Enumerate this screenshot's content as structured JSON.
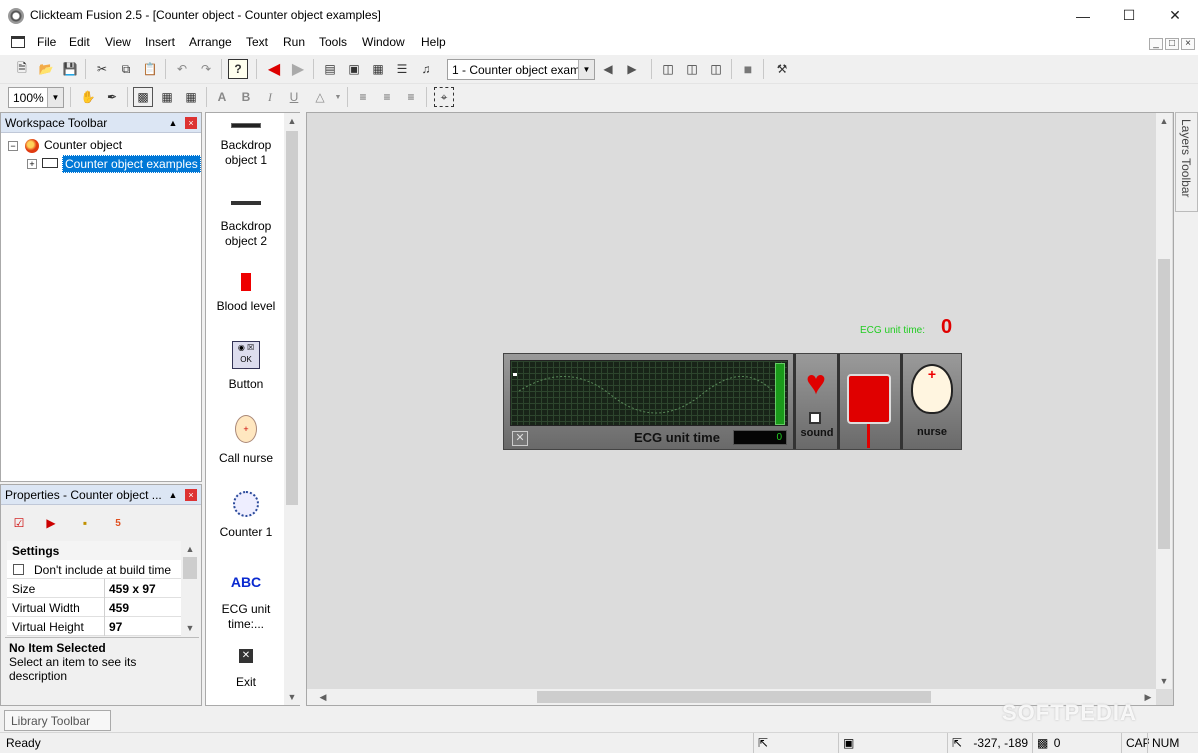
{
  "window": {
    "title": "Clickteam Fusion 2.5 - [Counter object - Counter object examples]",
    "minimize_icon": "minimize-icon",
    "maximize_icon": "maximize-icon",
    "close_icon": "close-icon"
  },
  "menu": [
    "File",
    "Edit",
    "View",
    "Insert",
    "Arrange",
    "Text",
    "Run",
    "Tools",
    "Window",
    "Help"
  ],
  "toolbar": {
    "frame_combo": "1 - Counter object exam",
    "zoom_combo": "100%"
  },
  "workspace": {
    "title": "Workspace Toolbar",
    "tree_root": "Counter object",
    "tree_child": "Counter object examples"
  },
  "properties": {
    "title": "Properties - Counter object ...",
    "section": "Settings",
    "checkbox_label": "Don't include at build time",
    "rows": [
      {
        "key": "Size",
        "value": "459 x 97"
      },
      {
        "key": "Virtual Width",
        "value": "459"
      },
      {
        "key": "Virtual Height",
        "value": "97"
      }
    ],
    "info_title": "No Item Selected",
    "info_desc": "Select an item to see its description"
  },
  "objects": [
    {
      "label": "Backdrop object 1",
      "icon": "backdrop-icon"
    },
    {
      "label": "Backdrop object 2",
      "icon": "backdrop-icon"
    },
    {
      "label": "Blood level",
      "icon": "blood-level-icon"
    },
    {
      "label": "Button",
      "icon": "button-icon"
    },
    {
      "label": "Call nurse",
      "icon": "nurse-icon"
    },
    {
      "label": "Counter 1",
      "icon": "counter-icon"
    },
    {
      "label": "ECG unit time:...",
      "icon": "text-abc-icon"
    },
    {
      "label": "Exit",
      "icon": "exit-icon"
    }
  ],
  "scene": {
    "ecg_label": "ECG unit time:",
    "ecg_value": "0",
    "panel_label": "ECG unit time",
    "panel_value": "0",
    "sound_label": "sound",
    "nurse_label": "nurse",
    "abc_text": "ABC"
  },
  "layers_tab": "Layers Toolbar",
  "library_tab": "Library Toolbar",
  "status": {
    "ready": "Ready",
    "coords": "-327, -189",
    "count": "0",
    "caps": "CAP",
    "num": "NUM"
  },
  "watermark": "SOFTPEDIA",
  "colors": {
    "accent": "#0078d7",
    "ecg_green": "#22cc22",
    "counter_red": "#e00000"
  }
}
